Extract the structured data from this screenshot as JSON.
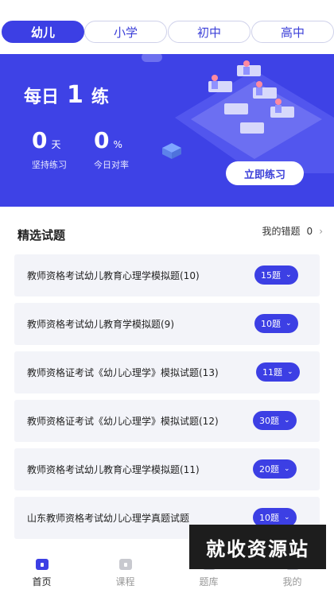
{
  "levels": [
    "幼儿",
    "小学",
    "初中",
    "高中"
  ],
  "hero": {
    "title_prefix": "每日",
    "title_number": "1",
    "title_suffix": "练",
    "days_value": "0",
    "days_unit": "天",
    "days_label": "坚持练习",
    "accuracy_value": "0",
    "accuracy_unit": "%",
    "accuracy_label": "今日对率",
    "practice_button": "立即练习"
  },
  "section": {
    "title": "精选试题",
    "wrong_label": "我的错题",
    "wrong_count": "0",
    "chevron": "›"
  },
  "questions": [
    {
      "title": "教师资格考试幼儿教育心理学模拟题(10)",
      "badge": "15题"
    },
    {
      "title": "教师资格考试幼儿教育学模拟题(9)",
      "badge": "10题"
    },
    {
      "title": "教师资格证考试《幼儿心理学》模拟试题(13)",
      "badge": "11题"
    },
    {
      "title": "教师资格证考试《幼儿心理学》模拟试题(12)",
      "badge": "30题"
    },
    {
      "title": "教师资格考试幼儿教育心理学模拟题(11)",
      "badge": "20题"
    },
    {
      "title": "山东教师资格考试幼儿心理学真题试题",
      "badge": "10题"
    }
  ],
  "tabs": [
    {
      "label": "首页",
      "icon": "home-icon"
    },
    {
      "label": "课程",
      "icon": "course-icon"
    },
    {
      "label": "题库",
      "icon": "question-bank-icon"
    },
    {
      "label": "我的",
      "icon": "profile-icon"
    }
  ],
  "watermark": "就收资源站",
  "colors": {
    "accent": "#3c3fe4",
    "hero_bg": "#3e42e6",
    "card_bg": "#f3f4f9"
  }
}
